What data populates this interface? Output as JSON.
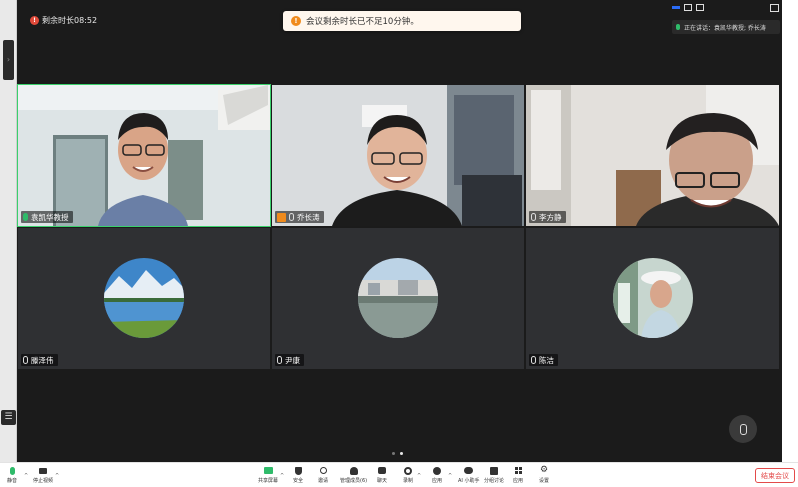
{
  "timer_text": "剩余时长08:52",
  "toast_text": "会议剩余时长已不足10分钟。",
  "speaking_text": "正在讲话：袁凯华教授; 乔长涛",
  "participants": [
    {
      "name": "袁凯华教授"
    },
    {
      "name": "乔长涛"
    },
    {
      "name": "李方静"
    },
    {
      "name": "滕泽伟"
    },
    {
      "name": "尹康"
    },
    {
      "name": "陈洁"
    }
  ],
  "toolbar": {
    "mute": "静音",
    "stop_video": "停止视频",
    "share_screen": "共享屏幕",
    "security": "安全",
    "invite": "邀请",
    "manage_members": "管理成员(6)",
    "chat": "聊天",
    "record": "录制",
    "apps": "应用",
    "ai_assistant": "AI 小助手",
    "breakout": "分组讨论",
    "applications": "应用",
    "settings": "设置",
    "end_meeting": "结束会议"
  },
  "colors": {
    "accent_green": "#2fbb6a",
    "end_red": "#e34a4a",
    "warn_orange": "#f08b1d"
  }
}
